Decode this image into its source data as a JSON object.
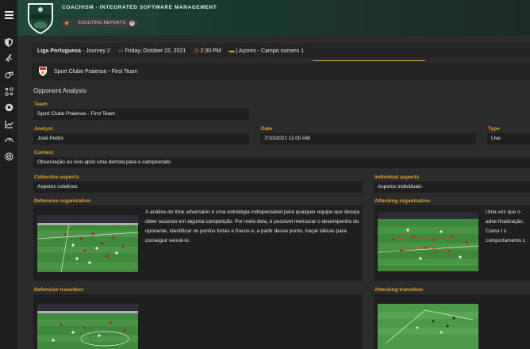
{
  "app": {
    "title": "COACHISM - INTEGRATED SOFTWARE MANAGEMENT",
    "logo_text": "COACHISM"
  },
  "tabs": [
    {
      "label": "SCOUTING REPORTS"
    }
  ],
  "match": {
    "league": "Liga Portuguesa",
    "journey": "- Journey 2",
    "date": "Friday, October 22, 2021",
    "time": "2:30 PM",
    "venue": "| Açores - Campo numero 1"
  },
  "team_header": {
    "name": "Sport Clube Praiense - First Team"
  },
  "form": {
    "section_title": "Opponent Analysis",
    "team_label": "Team",
    "team_value": "Sport Clube Praiense - First Team",
    "analyst_label": "Analyst",
    "analyst_value": "José Pedro",
    "date_label": "Date",
    "date_value": "7/10/2021 11:00 AM",
    "type_label": "Type",
    "type_value": "Live",
    "context_label": "Context",
    "context_value": "Observação ao vivo após uma derrota para o campeonato",
    "collective_label": "Collective aspects",
    "collective_value": "Aspetos coletivos",
    "individual_label": "Individual aspects",
    "individual_value": "Aspetos individuais",
    "defensive_org_label": "Defensive organization",
    "defensive_org_text": "A análise do time adversário é uma estratégia indispensável para qualquer equipe que deseja obter sucesso em alguma competição. Por meio dela, é possível mensurar o desempenho do oponente, identificar os pontos fortes e fracos e, a partir desse ponto, traçar táticas para conseguir vencê-lo.",
    "attacking_org_label": "Attacking organization",
    "attacking_org_text": "Uma vez que o adve finalização. Como t o comportamento c",
    "defensive_trans_label": "Defensive transition",
    "attacking_trans_label": "Attacking transition"
  },
  "colors": {
    "accent": "#e0a12a",
    "header_green": "#1f4a3a",
    "panel": "#1f1f1f",
    "background": "#2b2b2b"
  }
}
